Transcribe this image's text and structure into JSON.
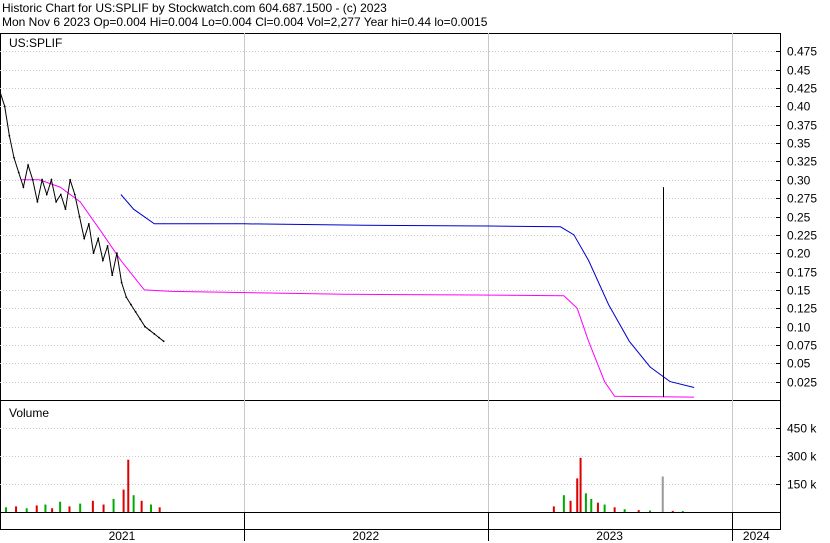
{
  "header": {
    "title": "Historic Chart for US:SPLIF by Stockwatch.com 604.687.1500 - (c) 2023",
    "quote": "Mon Nov  6 2023  Op=0.004  Hi=0.004  Lo=0.004  Cl=0.004  Vol=2,277  Year hi=0.44  lo=0.0015"
  },
  "chart_data": {
    "type": "line",
    "symbol_label": "US:SPLIF",
    "volume_label": "Volume",
    "price_axis": {
      "ylim": [
        0,
        0.5
      ],
      "ticks": [
        "0.475",
        "0.45",
        "0.425",
        "0.40",
        "0.375",
        "0.35",
        "0.325",
        "0.30",
        "0.275",
        "0.25",
        "0.225",
        "0.20",
        "0.175",
        "0.15",
        "0.125",
        "0.10",
        "0.075",
        "0.05",
        "0.025"
      ],
      "tick_values": [
        0.475,
        0.45,
        0.425,
        0.4,
        0.375,
        0.35,
        0.325,
        0.3,
        0.275,
        0.25,
        0.225,
        0.2,
        0.175,
        0.15,
        0.125,
        0.1,
        0.075,
        0.05,
        0.025
      ]
    },
    "volume_axis": {
      "ylim": [
        0,
        600000
      ],
      "ticks": [
        "450 k",
        "300 k",
        "150 k"
      ],
      "tick_values": [
        450000,
        300000,
        150000
      ]
    },
    "x_axis": {
      "xlim": [
        "2021-01-01",
        "2024-03-15"
      ],
      "years": [
        {
          "label": "2021",
          "start": "2021-01-01",
          "end": "2022-01-01"
        },
        {
          "label": "2022",
          "start": "2022-01-01",
          "end": "2023-01-01"
        },
        {
          "label": "2023",
          "start": "2023-01-01",
          "end": "2024-01-01"
        },
        {
          "label": "2024",
          "start": "2024-01-01",
          "end": "2024-03-15"
        }
      ]
    },
    "colors": {
      "price": "#000000",
      "ma_short": "#ff00ff",
      "ma_long": "#0000cc",
      "vol_up": "#00aa00",
      "vol_down": "#dd0000",
      "vol_flat": "#999999",
      "grid": "#c8c8c8",
      "frame": "#000000"
    },
    "price_series": [
      {
        "x": "2021-01-01",
        "y": 0.42
      },
      {
        "x": "2021-01-08",
        "y": 0.4
      },
      {
        "x": "2021-01-15",
        "y": 0.36
      },
      {
        "x": "2021-01-22",
        "y": 0.33
      },
      {
        "x": "2021-01-29",
        "y": 0.31
      },
      {
        "x": "2021-02-05",
        "y": 0.29
      },
      {
        "x": "2021-02-12",
        "y": 0.32
      },
      {
        "x": "2021-02-19",
        "y": 0.3
      },
      {
        "x": "2021-02-26",
        "y": 0.27
      },
      {
        "x": "2021-03-05",
        "y": 0.3
      },
      {
        "x": "2021-03-12",
        "y": 0.28
      },
      {
        "x": "2021-03-19",
        "y": 0.3
      },
      {
        "x": "2021-03-26",
        "y": 0.27
      },
      {
        "x": "2021-04-02",
        "y": 0.28
      },
      {
        "x": "2021-04-09",
        "y": 0.26
      },
      {
        "x": "2021-04-16",
        "y": 0.3
      },
      {
        "x": "2021-04-23",
        "y": 0.28
      },
      {
        "x": "2021-04-30",
        "y": 0.25
      },
      {
        "x": "2021-05-07",
        "y": 0.22
      },
      {
        "x": "2021-05-14",
        "y": 0.24
      },
      {
        "x": "2021-05-21",
        "y": 0.2
      },
      {
        "x": "2021-05-28",
        "y": 0.22
      },
      {
        "x": "2021-06-04",
        "y": 0.19
      },
      {
        "x": "2021-06-11",
        "y": 0.21
      },
      {
        "x": "2021-06-18",
        "y": 0.17
      },
      {
        "x": "2021-06-25",
        "y": 0.2
      },
      {
        "x": "2021-07-02",
        "y": 0.16
      },
      {
        "x": "2021-07-09",
        "y": 0.14
      },
      {
        "x": "2021-07-16",
        "y": 0.13
      },
      {
        "x": "2021-07-23",
        "y": 0.12
      },
      {
        "x": "2021-07-30",
        "y": 0.11
      },
      {
        "x": "2021-08-06",
        "y": 0.1
      },
      {
        "x": "2021-08-13",
        "y": 0.095
      },
      {
        "x": "2021-08-20",
        "y": 0.09
      },
      {
        "x": "2021-08-27",
        "y": 0.085
      },
      {
        "x": "2021-09-03",
        "y": 0.08
      }
    ],
    "ma_short_series": [
      {
        "x": "2021-02-01",
        "y": 0.3
      },
      {
        "x": "2021-03-01",
        "y": 0.3
      },
      {
        "x": "2021-04-01",
        "y": 0.29
      },
      {
        "x": "2021-05-01",
        "y": 0.27
      },
      {
        "x": "2021-06-01",
        "y": 0.23
      },
      {
        "x": "2021-07-01",
        "y": 0.19
      },
      {
        "x": "2021-08-05",
        "y": 0.15
      },
      {
        "x": "2021-09-15",
        "y": 0.148
      },
      {
        "x": "2022-06-01",
        "y": 0.144
      },
      {
        "x": "2022-12-15",
        "y": 0.143
      },
      {
        "x": "2023-04-25",
        "y": 0.142
      },
      {
        "x": "2023-05-15",
        "y": 0.125
      },
      {
        "x": "2023-06-01",
        "y": 0.08
      },
      {
        "x": "2023-06-25",
        "y": 0.025
      },
      {
        "x": "2023-07-10",
        "y": 0.005
      },
      {
        "x": "2023-11-06",
        "y": 0.004
      }
    ],
    "ma_long_series": [
      {
        "x": "2021-07-01",
        "y": 0.28
      },
      {
        "x": "2021-07-20",
        "y": 0.26
      },
      {
        "x": "2021-08-20",
        "y": 0.24
      },
      {
        "x": "2022-01-01",
        "y": 0.24
      },
      {
        "x": "2022-07-01",
        "y": 0.238
      },
      {
        "x": "2023-01-01",
        "y": 0.237
      },
      {
        "x": "2023-04-20",
        "y": 0.236
      },
      {
        "x": "2023-05-10",
        "y": 0.225
      },
      {
        "x": "2023-06-01",
        "y": 0.19
      },
      {
        "x": "2023-07-01",
        "y": 0.13
      },
      {
        "x": "2023-08-01",
        "y": 0.08
      },
      {
        "x": "2023-09-01",
        "y": 0.045
      },
      {
        "x": "2023-10-01",
        "y": 0.025
      },
      {
        "x": "2023-11-06",
        "y": 0.017
      }
    ],
    "spike": {
      "x": "2023-09-20",
      "low": 0.004,
      "high": 0.29
    },
    "volume_series": [
      {
        "x": "2021-01-10",
        "v": 25000,
        "c": "up"
      },
      {
        "x": "2021-01-25",
        "v": 30000,
        "c": "down"
      },
      {
        "x": "2021-02-10",
        "v": 20000,
        "c": "up"
      },
      {
        "x": "2021-02-25",
        "v": 35000,
        "c": "down"
      },
      {
        "x": "2021-03-10",
        "v": 40000,
        "c": "up"
      },
      {
        "x": "2021-03-20",
        "v": 20000,
        "c": "down"
      },
      {
        "x": "2021-04-01",
        "v": 55000,
        "c": "up"
      },
      {
        "x": "2021-04-15",
        "v": 30000,
        "c": "down"
      },
      {
        "x": "2021-05-01",
        "v": 45000,
        "c": "up"
      },
      {
        "x": "2021-05-20",
        "v": 60000,
        "c": "down"
      },
      {
        "x": "2021-06-05",
        "v": 40000,
        "c": "down"
      },
      {
        "x": "2021-06-20",
        "v": 70000,
        "c": "up"
      },
      {
        "x": "2021-07-05",
        "v": 120000,
        "c": "down"
      },
      {
        "x": "2021-07-12",
        "v": 280000,
        "c": "down"
      },
      {
        "x": "2021-07-20",
        "v": 90000,
        "c": "up"
      },
      {
        "x": "2021-08-01",
        "v": 60000,
        "c": "down"
      },
      {
        "x": "2021-08-15",
        "v": 40000,
        "c": "up"
      },
      {
        "x": "2021-08-28",
        "v": 25000,
        "c": "down"
      },
      {
        "x": "2023-04-10",
        "v": 30000,
        "c": "down"
      },
      {
        "x": "2023-04-25",
        "v": 90000,
        "c": "up"
      },
      {
        "x": "2023-05-05",
        "v": 60000,
        "c": "down"
      },
      {
        "x": "2023-05-15",
        "v": 180000,
        "c": "down"
      },
      {
        "x": "2023-05-20",
        "v": 290000,
        "c": "down"
      },
      {
        "x": "2023-05-28",
        "v": 100000,
        "c": "up"
      },
      {
        "x": "2023-06-05",
        "v": 70000,
        "c": "up"
      },
      {
        "x": "2023-06-15",
        "v": 50000,
        "c": "down"
      },
      {
        "x": "2023-06-25",
        "v": 40000,
        "c": "up"
      },
      {
        "x": "2023-07-10",
        "v": 25000,
        "c": "down"
      },
      {
        "x": "2023-07-25",
        "v": 15000,
        "c": "up"
      },
      {
        "x": "2023-08-15",
        "v": 10000,
        "c": "down"
      },
      {
        "x": "2023-09-01",
        "v": 8000,
        "c": "up"
      },
      {
        "x": "2023-09-20",
        "v": 190000,
        "c": "flat"
      },
      {
        "x": "2023-10-05",
        "v": 6000,
        "c": "down"
      },
      {
        "x": "2023-10-20",
        "v": 5000,
        "c": "up"
      }
    ]
  }
}
